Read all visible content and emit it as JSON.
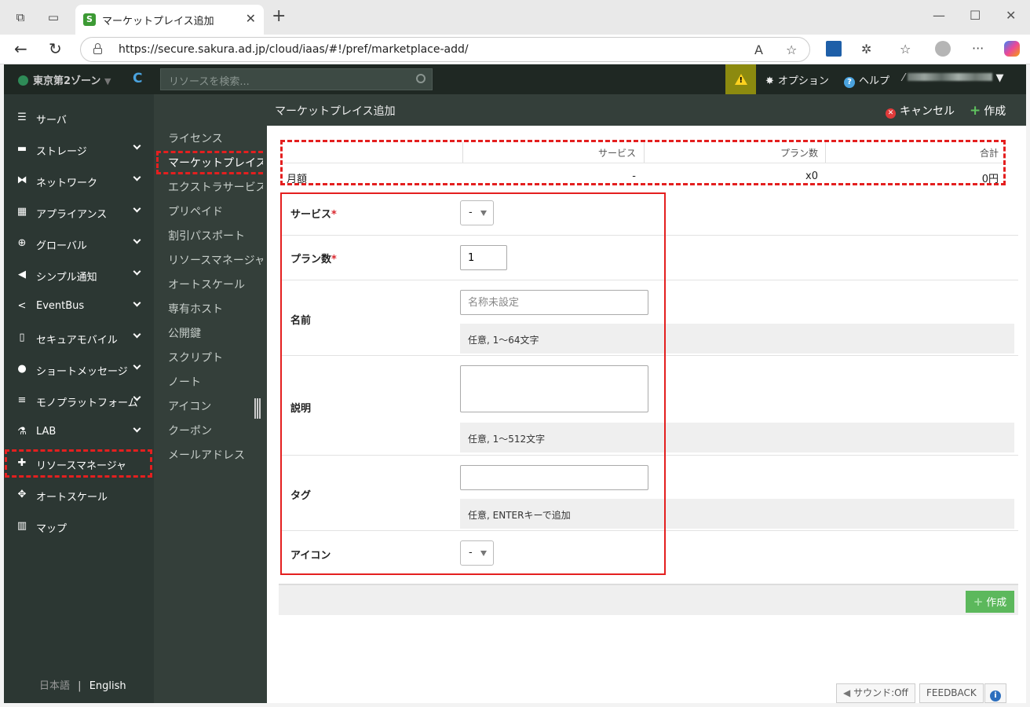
{
  "browser": {
    "tab_title": "マーケットプレイス追加",
    "url": "https://secure.sakura.ad.jp/cloud/iaas/#!/pref/marketplace-add/"
  },
  "topbar": {
    "zone": "東京第2ゾーン",
    "search_placeholder": "リソースを検索...",
    "options": "オプション",
    "help": "ヘルプ"
  },
  "sidebar": {
    "items": [
      {
        "label": "サーバ",
        "icon": "server-icon"
      },
      {
        "label": "ストレージ",
        "icon": "storage-icon"
      },
      {
        "label": "ネットワーク",
        "icon": "network-icon"
      },
      {
        "label": "アプライアンス",
        "icon": "appliance-icon"
      },
      {
        "label": "グローバル",
        "icon": "globe-icon"
      },
      {
        "label": "シンプル通知",
        "icon": "megaphone-icon"
      },
      {
        "label": "EventBus",
        "icon": "share-icon"
      },
      {
        "label": "セキュアモバイル",
        "icon": "mobile-icon"
      },
      {
        "label": "ショートメッセージ",
        "icon": "chat-icon"
      },
      {
        "label": "モノプラットフォーム",
        "icon": "list-icon"
      },
      {
        "label": "LAB",
        "icon": "flask-icon"
      },
      {
        "label": "リソースマネージャ",
        "icon": "puzzle-icon"
      },
      {
        "label": "オートスケール",
        "icon": "move-icon"
      },
      {
        "label": "マップ",
        "icon": "map-icon"
      }
    ],
    "lang_ja": "日本語",
    "lang_sep": "|",
    "lang_en": "English"
  },
  "subnav": {
    "items": [
      "ライセンス",
      "マーケットプレイス",
      "エクストラサービス",
      "プリペイド",
      "割引パスポート",
      "リソースマネージャ",
      "オートスケール",
      "専有ホスト",
      "公開鍵",
      "スクリプト",
      "ノート",
      "アイコン",
      "クーポン",
      "メールアドレス"
    ]
  },
  "main": {
    "title": "マーケットプレイス追加",
    "cancel": "キャンセル",
    "create": "作成"
  },
  "summary": {
    "headers": [
      "サービス",
      "プラン数",
      "合計"
    ],
    "row_label": "月額",
    "service": "-",
    "plans": "x0",
    "total": "0円"
  },
  "form": {
    "service_label": "サービス",
    "service_value": "-",
    "plans_label": "プラン数",
    "plans_value": "1",
    "name_label": "名前",
    "name_placeholder": "名称未設定",
    "name_hint": "任意, 1〜64文字",
    "desc_label": "説明",
    "desc_hint": "任意, 1〜512文字",
    "tag_label": "タグ",
    "tag_hint": "任意, ENTERキーで追加",
    "icon_label": "アイコン",
    "icon_value": "-",
    "required_mark": "*",
    "submit": "作成"
  },
  "footer": {
    "sound": "サウンド:Off",
    "feedback": "FEEDBACK"
  },
  "colors": {
    "annotation": "#e41f1f",
    "create_green": "#5cb85c",
    "sidebar_bg": "#2c3733"
  }
}
